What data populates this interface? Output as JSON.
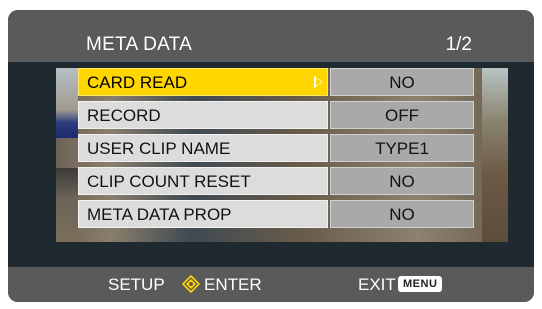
{
  "header": {
    "title": "META DATA",
    "page": "1/2"
  },
  "menu": {
    "items": [
      {
        "label": "CARD READ",
        "value": "NO"
      },
      {
        "label": "RECORD",
        "value": "OFF"
      },
      {
        "label": "USER CLIP NAME",
        "value": "TYPE1"
      },
      {
        "label": "CLIP COUNT RESET",
        "value": "NO"
      },
      {
        "label": "META DATA PROP",
        "value": "NO"
      }
    ],
    "selected_index": 0
  },
  "footer": {
    "setup_label": "SETUP",
    "enter_label": "ENTER",
    "exit_label": "EXIT",
    "menu_key": "MENU"
  },
  "icons": {
    "selection_arrow": "right-triangle-icon",
    "navigation": "dpad-icon"
  },
  "colors": {
    "selected_row": "#ffd600",
    "row_label_bg": "#dcdcdc",
    "row_value_bg": "#a9a9a9",
    "bar_bg": "#5a5a5a"
  }
}
